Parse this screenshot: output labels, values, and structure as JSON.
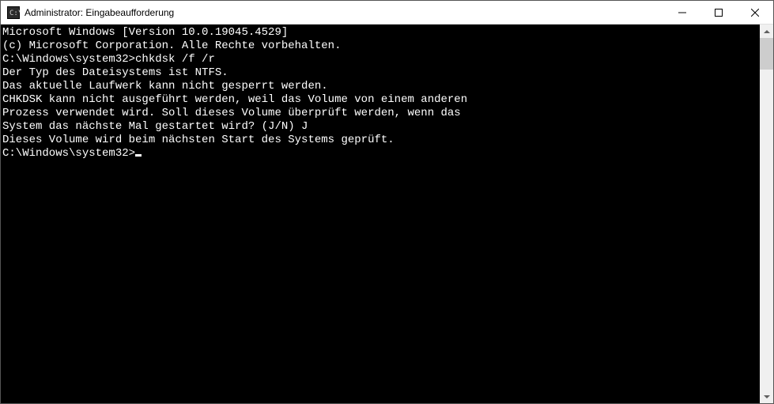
{
  "titlebar": {
    "title": "Administrator: Eingabeaufforderung"
  },
  "terminal": {
    "lines": [
      "Microsoft Windows [Version 10.0.19045.4529]",
      "(c) Microsoft Corporation. Alle Rechte vorbehalten.",
      "",
      "C:\\Windows\\system32>chkdsk /f /r",
      "Der Typ des Dateisystems ist NTFS.",
      "Das aktuelle Laufwerk kann nicht gesperrt werden.",
      "",
      "CHKDSK kann nicht ausgeführt werden, weil das Volume von einem anderen",
      "Prozess verwendet wird. Soll dieses Volume überprüft werden, wenn das",
      "System das nächste Mal gestartet wird? (J/N) J",
      "",
      "Dieses Volume wird beim nächsten Start des Systems geprüft.",
      ""
    ],
    "prompt": "C:\\Windows\\system32>"
  }
}
